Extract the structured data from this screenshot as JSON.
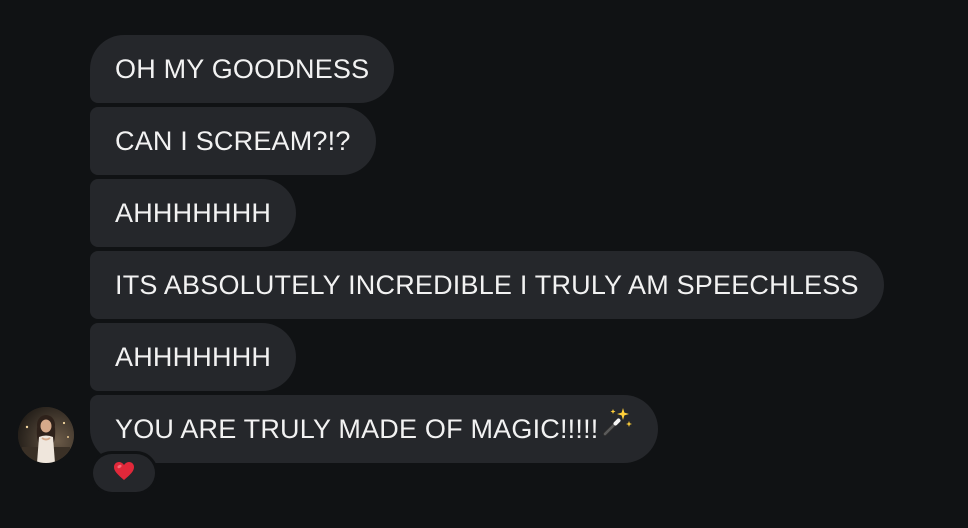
{
  "thread": {
    "messages": [
      {
        "text": "OH MY GOODNESS"
      },
      {
        "text": "CAN I SCREAM?!?"
      },
      {
        "text": "AHHHHHHH"
      },
      {
        "text": "ITS ABSOLUTELY INCREDIBLE I TRULY AM SPEECHLESS"
      },
      {
        "text": "AHHHHHHH"
      },
      {
        "text": "YOU ARE TRULY MADE OF MAGIC!!!!!",
        "trailing_emoji": "magic-wand-icon"
      }
    ],
    "reaction": {
      "emoji": "heart-icon",
      "color": "#e1283a"
    },
    "sender_avatar": "avatar"
  },
  "colors": {
    "background": "#101214",
    "bubble": "#25272b",
    "text": "#f2f2f2"
  }
}
